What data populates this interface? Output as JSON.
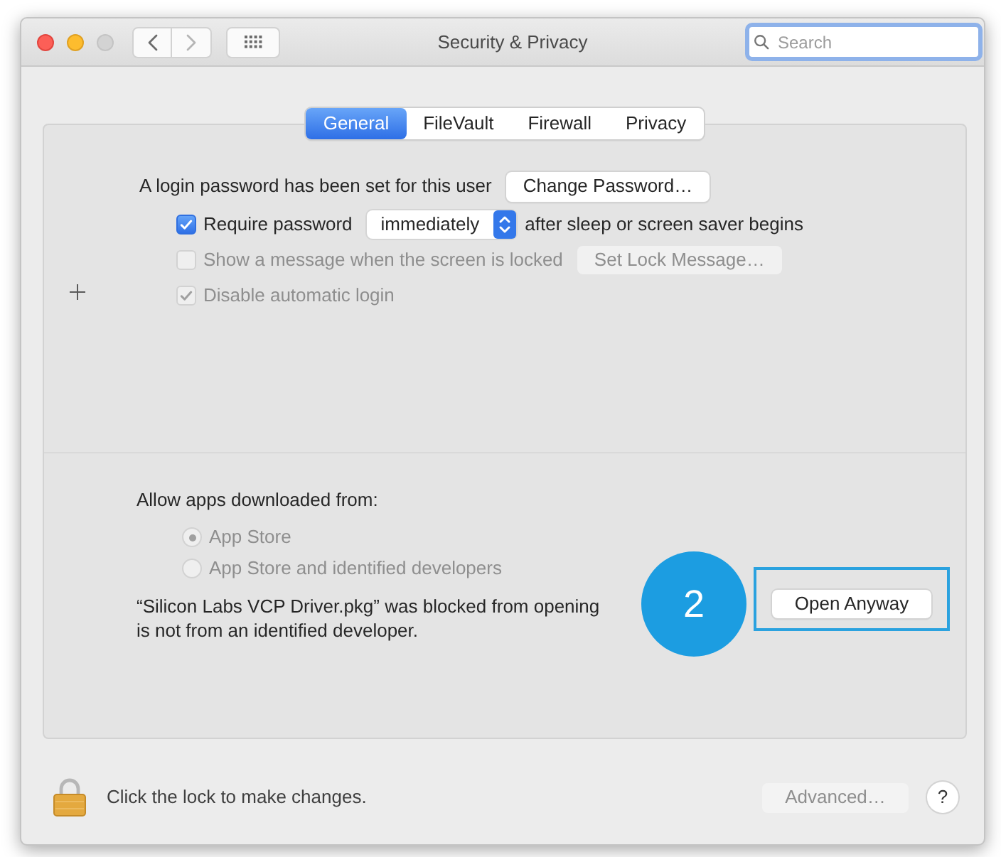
{
  "window": {
    "title": "Security & Privacy",
    "search": {
      "placeholder": "Search"
    }
  },
  "tabs": [
    {
      "label": "General",
      "selected": true
    },
    {
      "label": "FileVault",
      "selected": false
    },
    {
      "label": "Firewall",
      "selected": false
    },
    {
      "label": "Privacy",
      "selected": false
    }
  ],
  "login": {
    "text": "A login password has been set for this user",
    "button": "Change Password…"
  },
  "options": [
    {
      "kind": "checkbox",
      "label": "Require password",
      "checked": true,
      "disabled": false,
      "popup": "immediately",
      "after": "after sleep or screen saver begins"
    },
    {
      "kind": "checkbox",
      "label": "Show a message when the screen is locked",
      "checked": false,
      "disabled": true,
      "button": "Set Lock Message…"
    },
    {
      "kind": "checkbox",
      "label": "Disable automatic login",
      "checked": true,
      "disabled": true
    }
  ],
  "gatekeeper": {
    "heading": "Allow apps downloaded from:",
    "sources": [
      {
        "label": "App Store",
        "selected": true,
        "disabled": true
      },
      {
        "label": "App Store and identified developers",
        "selected": false,
        "disabled": true
      }
    ],
    "message_lines": [
      "“Silicon Labs VCP Driver.pkg” was blocked from opening",
      "is not from an identified developer."
    ],
    "open_button": "Open Anyway"
  },
  "annotation": {
    "step": "2"
  },
  "footer": {
    "lock_text": "Click the lock to make changes.",
    "advanced_button": {
      "label": "Advanced…",
      "disabled": true
    },
    "help_button": "?"
  }
}
